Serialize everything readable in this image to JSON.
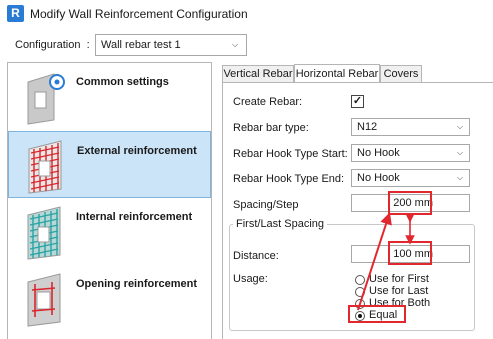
{
  "window": {
    "title": "Modify Wall Reinforcement Configuration",
    "app_icon_letter": "R"
  },
  "configuration": {
    "label": "Configuration",
    "separator": ":",
    "value": "Wall rebar test 1"
  },
  "nav": {
    "items": [
      {
        "label": "Common settings",
        "icon": "gear-wall-icon",
        "selected": false
      },
      {
        "label": "External reinforcement",
        "icon": "wall-mesh-icon",
        "selected": true
      },
      {
        "label": "Internal reinforcement",
        "icon": "wall-mesh-teal-icon",
        "selected": false
      },
      {
        "label": "Opening reinforcement",
        "icon": "opening-bars-icon",
        "selected": false
      }
    ]
  },
  "tabs": [
    {
      "label": "Vertical Rebar",
      "active": false
    },
    {
      "label": "Horizontal Rebar",
      "active": true
    },
    {
      "label": "Covers",
      "active": false
    }
  ],
  "form": {
    "create_rebar_label": "Create Rebar:",
    "create_rebar_checked": true,
    "bar_type_label": "Rebar bar type:",
    "bar_type_value": "N12",
    "hook_start_label": "Rebar Hook Type Start:",
    "hook_start_value": "No Hook",
    "hook_end_label": "Rebar Hook Type End:",
    "hook_end_value": "No Hook",
    "spacing_label": "Spacing/Step",
    "spacing_value": "200 mm",
    "first_last_group_label": "First/Last Spacing",
    "distance_label": "Distance:",
    "distance_value": "100 mm",
    "usage_label": "Usage:",
    "usage_options": [
      {
        "label": "Use for First",
        "checked": false
      },
      {
        "label": "Use for Last",
        "checked": false
      },
      {
        "label": "Use for Both",
        "checked": false
      },
      {
        "label": "Equal",
        "checked": true
      }
    ]
  },
  "colors": {
    "annotation_red": "#e0282e",
    "selection_blue": "#cce4f7",
    "mesh_red": "#d9262c",
    "mesh_teal": "#2aa3a3"
  }
}
